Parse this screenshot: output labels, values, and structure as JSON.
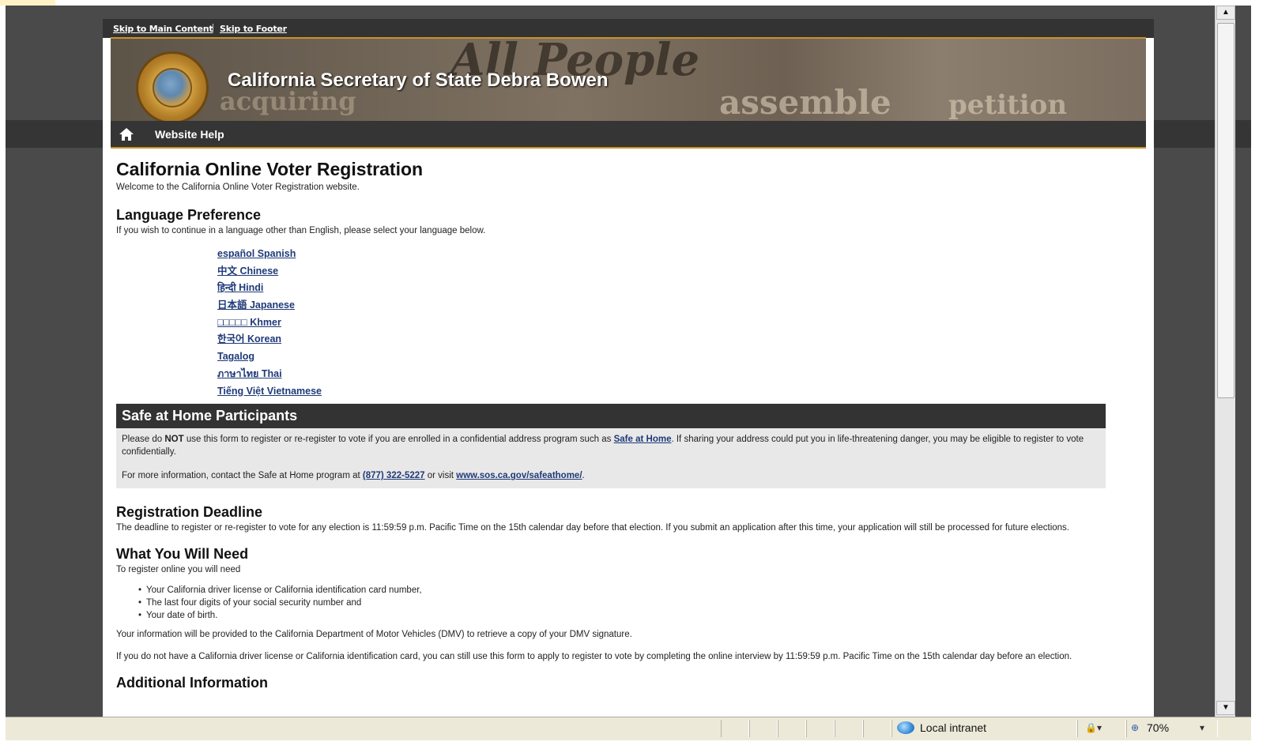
{
  "skip_links": [
    "Skip to Main Content",
    "Skip to Footer"
  ],
  "skip_separator": "|",
  "banner": {
    "title": "California Secretary of State Debra Bowen",
    "background_words": [
      "All People",
      "assemble",
      "petition",
      "acquiring"
    ]
  },
  "topnav": {
    "help_label": "Website Help"
  },
  "main": {
    "title": "California Online Voter Registration",
    "welcome": "Welcome to the California Online Voter Registration website.",
    "language_section": {
      "heading": "Language Preference",
      "intro": "If you wish to continue in a language other than English, please select your language below.",
      "languages": [
        "español Spanish",
        "中文 Chinese",
        "हिन्दी Hindi",
        "日本語 Japanese",
        "□□□□□ Khmer",
        "한국어 Korean",
        "Tagalog",
        "ภาษาไทย Thai",
        "Tiếng Việt Vietnamese"
      ]
    },
    "safe_at_home": {
      "heading": "Safe at Home Participants",
      "p1_before": "Please do ",
      "p1_strong": "NOT",
      "p1_middle": " use this form to register or re-register to vote if you are enrolled in a confidential address program such as ",
      "p1_link": "Safe at Home",
      "p1_after": ". If sharing your address could put you in life-threatening danger, you may be eligible to register to vote confidentially.",
      "p2_before": "For more information, contact the Safe at Home program at ",
      "p2_phone": "(877) 322-5227",
      "p2_middle": " or visit ",
      "p2_url": "www.sos.ca.gov/safeathome/",
      "p2_after": "."
    },
    "deadline": {
      "heading": "Registration Deadline",
      "text": "The deadline to register or re-register to vote for any election is 11:59:59 p.m. Pacific Time on the 15th calendar day before that election. If you submit an application after this time, your application will still be processed for future elections."
    },
    "need": {
      "heading": "What You Will Need",
      "intro": "To register online you will need",
      "items": [
        "Your California driver license or California identification card number,",
        "The last four digits of your social security number and",
        "Your date of birth."
      ],
      "p1": "Your information will be provided to the California Department of Motor Vehicles (DMV) to retrieve a copy of your DMV signature.",
      "p2": "If you do not have a California driver license or California identification card, you can still use this form to apply to register to vote by completing the online interview by 11:59:59 p.m. Pacific Time on the 15th calendar day before an election."
    },
    "additional": {
      "heading": "Additional Information"
    }
  },
  "statusbar": {
    "zone": "Local intranet",
    "zoom": "70%"
  },
  "colors": {
    "accent": "#c8922a",
    "dark_bar": "#333333",
    "link": "#1f3a78",
    "notice_bg": "#e8e8e8"
  },
  "icons": [
    "home-icon",
    "seal-logo",
    "globe-icon",
    "zoom-icon",
    "scroll-up-icon",
    "scroll-down-icon"
  ]
}
